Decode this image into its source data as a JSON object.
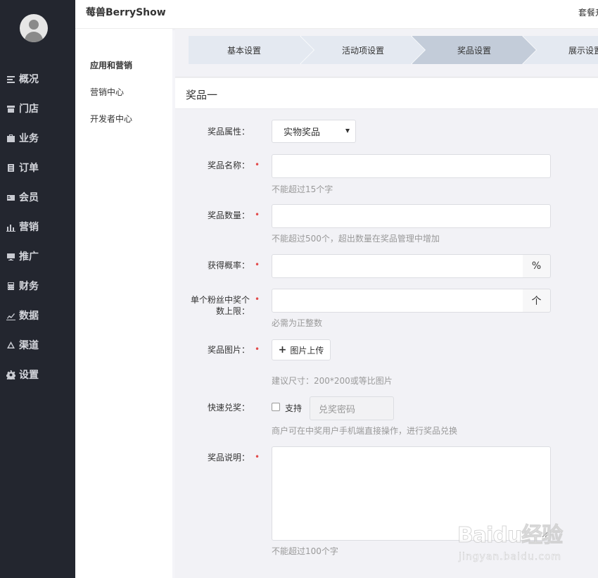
{
  "header": {
    "brand": "莓兽BerryShow",
    "right_text": "套餐升"
  },
  "sidebar": {
    "items": [
      {
        "label": "概况",
        "icon": "overview-icon"
      },
      {
        "label": "门店",
        "icon": "store-icon"
      },
      {
        "label": "业务",
        "icon": "briefcase-icon"
      },
      {
        "label": "订单",
        "icon": "order-icon"
      },
      {
        "label": "会员",
        "icon": "member-card-icon"
      },
      {
        "label": "营销",
        "icon": "bar-chart-icon"
      },
      {
        "label": "推广",
        "icon": "monitor-icon"
      },
      {
        "label": "财务",
        "icon": "calculator-icon"
      },
      {
        "label": "数据",
        "icon": "line-chart-icon"
      },
      {
        "label": "渠道",
        "icon": "channel-icon"
      },
      {
        "label": "设置",
        "icon": "gear-icon"
      }
    ]
  },
  "subnav": {
    "group_title": "应用和营销",
    "links": [
      "营销中心",
      "开发者中心"
    ]
  },
  "steps": [
    {
      "label": "基本设置",
      "active": false
    },
    {
      "label": "活动项设置",
      "active": false
    },
    {
      "label": "奖品设置",
      "active": true
    },
    {
      "label": "展示设置",
      "active": false
    }
  ],
  "card": {
    "title": "奖品一",
    "toggle": "-"
  },
  "form": {
    "attr": {
      "label": "奖品属性：",
      "value": "实物奖品"
    },
    "name": {
      "label": "奖品名称：",
      "required": "•",
      "hint": "不能超过15个字"
    },
    "qty": {
      "label": "奖品数量：",
      "required": "•",
      "hint": "不能超过500个，超出数量在奖品管理中增加"
    },
    "prob": {
      "label": "获得概率：",
      "required": "•",
      "addon": "%"
    },
    "limit": {
      "label_line1": "单个粉丝中奖个",
      "label_line2": "数上限：",
      "required": "•",
      "addon": "个",
      "hint": "必需为正整数"
    },
    "image": {
      "label": "奖品图片：",
      "required": "•",
      "button": "图片上传",
      "hint": "建议尺寸：200*200或等比图片"
    },
    "quick": {
      "label": "快速兑奖：",
      "checkbox_label": "支持",
      "code_placeholder": "兑奖密码",
      "hint": "商户可在中奖用户手机端直接操作，进行奖品兑换"
    },
    "desc": {
      "label": "奖品说明：",
      "required": "•",
      "hint": "不能超过100个字"
    }
  },
  "watermark": {
    "logo": "Baidu经验",
    "sub": "jingyan.baidu.com"
  }
}
